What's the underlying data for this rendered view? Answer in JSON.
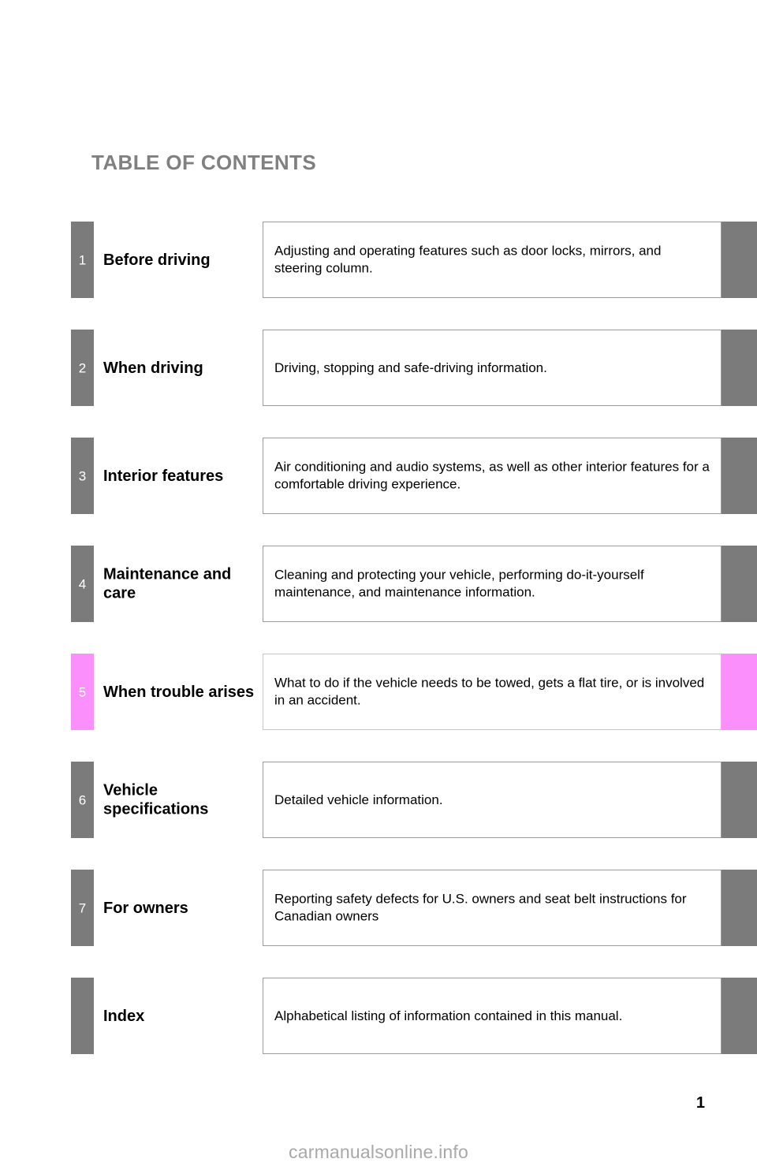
{
  "page": {
    "title": "TABLE OF CONTENTS",
    "page_number": "1",
    "watermark": "carmanualsonline.info"
  },
  "colors": {
    "tab_default": "#7b7b7b",
    "tab_highlight": "#fb8ffb",
    "box_border_default": "#9a9a9a",
    "box_border_highlight": "#f9a0f9",
    "title_gray": "#808080"
  },
  "toc": {
    "rows": [
      {
        "number": "1",
        "name": "Before driving",
        "description": "Adjusting and operating features such as door locks, mirrors, and steering column.",
        "highlighted": false
      },
      {
        "number": "2",
        "name": "When driving",
        "description": "Driving, stopping and safe-driving information.",
        "highlighted": false
      },
      {
        "number": "3",
        "name": "Interior features",
        "description": "Air conditioning and audio systems, as well as other interior features for a comfortable driving experience.",
        "highlighted": false
      },
      {
        "number": "4",
        "name": "Maintenance and care",
        "description": "Cleaning and protecting your vehicle, performing do-it-yourself maintenance, and maintenance information.",
        "highlighted": false
      },
      {
        "number": "5",
        "name": "When trouble arises",
        "description": "What to do if the vehicle needs to be towed, gets a flat tire, or is involved in an accident.",
        "highlighted": true
      },
      {
        "number": "6",
        "name": "Vehicle specifications",
        "description": "Detailed vehicle information.",
        "highlighted": false
      },
      {
        "number": "7",
        "name": "For owners",
        "description": "Reporting safety defects for U.S. owners and seat belt instructions for Canadian owners",
        "highlighted": false
      },
      {
        "number": "",
        "name": "Index",
        "description": "Alphabetical listing of information contained in this manual.",
        "highlighted": false
      }
    ]
  }
}
